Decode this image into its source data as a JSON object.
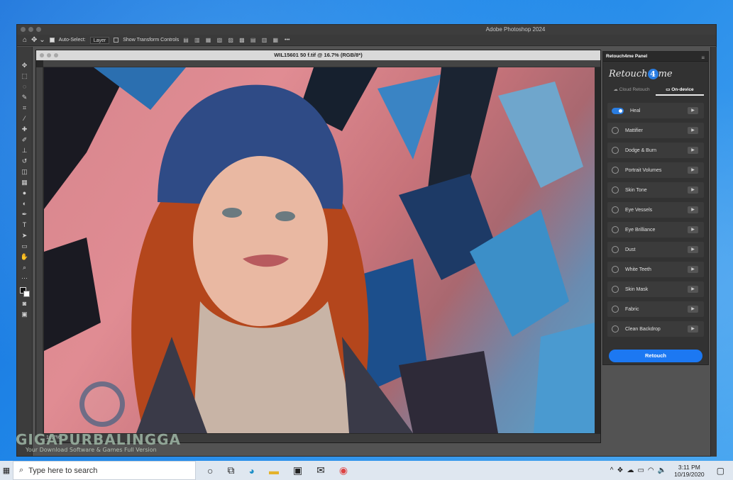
{
  "app": {
    "title": "Adobe Photoshop 2024"
  },
  "options_bar": {
    "auto_select_label": "Auto-Select:",
    "auto_select_value": "Layer",
    "transform_label": "Show Transform Controls",
    "more": "•••"
  },
  "document": {
    "tab_title": "WIL15601 50 f.tif @ 16.7% (RGB/8*)",
    "zoom": "16.7%"
  },
  "panel": {
    "tab_title": "Retouch4me Panel",
    "logo_left": "Retouch",
    "logo_mid": "4",
    "logo_right": "me",
    "modes": [
      "Cloud Retouch",
      "On-device"
    ],
    "active_mode": "On-device",
    "items": [
      {
        "label": "Heal",
        "enabled": true
      },
      {
        "label": "Mattifier",
        "enabled": false
      },
      {
        "label": "Dodge & Burn",
        "enabled": false
      },
      {
        "label": "Portrait Volumes",
        "enabled": false
      },
      {
        "label": "Skin Tone",
        "enabled": false
      },
      {
        "label": "Eye Vessels",
        "enabled": false
      },
      {
        "label": "Eye Brilliance",
        "enabled": false
      },
      {
        "label": "Dust",
        "enabled": false
      },
      {
        "label": "White Teeth",
        "enabled": false
      },
      {
        "label": "Skin Mask",
        "enabled": false
      },
      {
        "label": "Fabric",
        "enabled": false
      },
      {
        "label": "Clean Backdrop",
        "enabled": false
      }
    ],
    "retouch_button": "Retouch"
  },
  "watermark": {
    "main": "GIGAPURBALINGGA",
    "sub": "Your Download Software & Games Full Version"
  },
  "taskbar": {
    "search_placeholder": "Type here to search",
    "time": "3:11 PM",
    "date": "10/19/2020"
  },
  "colors": {
    "accent": "#1c78f2",
    "panel_bg": "#323232",
    "ps_bg": "#535353"
  }
}
